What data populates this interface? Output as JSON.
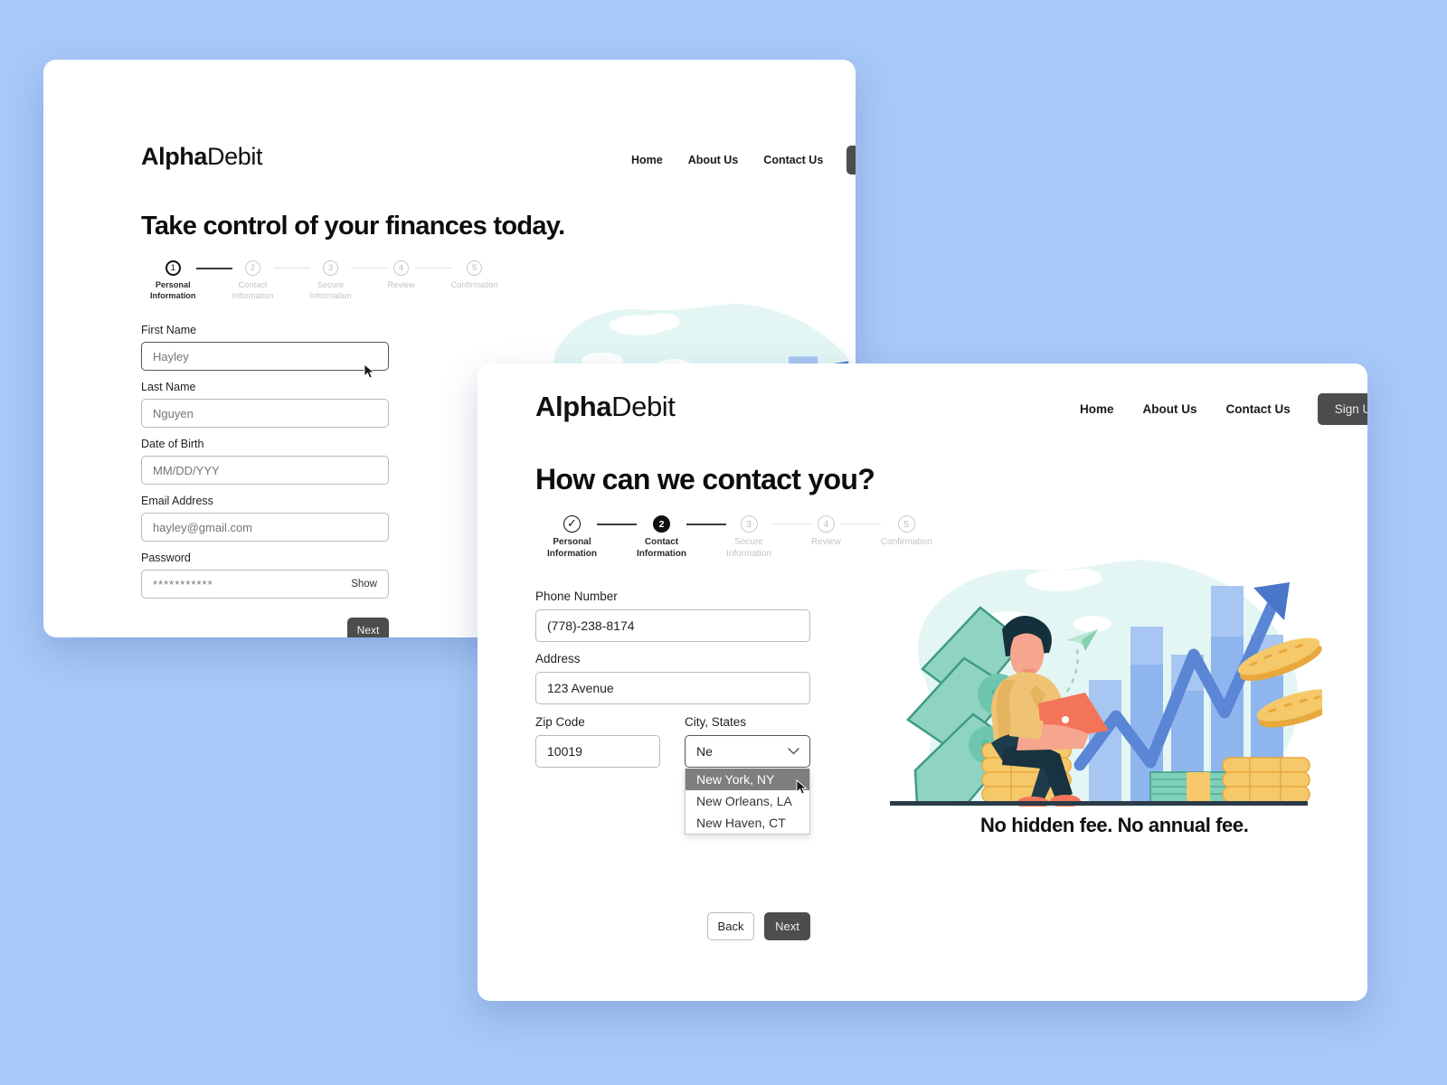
{
  "page": {
    "background_color": "#a8c8f9",
    "accent_dark": "#4d4d4d",
    "text_dark": "#111111",
    "muted_gray": "#c4c4c4"
  },
  "brand": {
    "bold_part": "Alpha",
    "light_part": "Debit"
  },
  "nav": {
    "links": [
      {
        "label": "Home"
      },
      {
        "label": "About Us"
      },
      {
        "label": "Contact Us"
      }
    ],
    "signup_label": "Sign Up"
  },
  "window_back": {
    "headline": "Take control of your finances today.",
    "stepper": [
      {
        "number": "1",
        "line1": "Personal",
        "line2": "Information",
        "state": "active"
      },
      {
        "number": "2",
        "line1": "Contact",
        "line2": "Information",
        "state": "pending"
      },
      {
        "number": "3",
        "line1": "Secure",
        "line2": "Information",
        "state": "pending"
      },
      {
        "number": "4",
        "line1": "Review",
        "line2": "",
        "state": "pending"
      },
      {
        "number": "5",
        "line1": "Confirmation",
        "line2": "",
        "state": "pending"
      }
    ],
    "fields": {
      "first_name": {
        "label": "First Name",
        "placeholder": "Hayley",
        "value": ""
      },
      "last_name": {
        "label": "Last Name",
        "placeholder": "Nguyen",
        "value": ""
      },
      "date_of_birth": {
        "label": "Date of Birth",
        "placeholder": "MM/DD/YYY",
        "value": ""
      },
      "email": {
        "label": "Email Address",
        "placeholder": "hayley@gmail.com",
        "value": ""
      },
      "password": {
        "label": "Password",
        "value": "***********",
        "show_label": "Show"
      }
    },
    "next_label": "Next"
  },
  "window_front": {
    "headline": "How can we contact you?",
    "stepper": [
      {
        "number": "✓",
        "line1": "Personal",
        "line2": "Information",
        "state": "done"
      },
      {
        "number": "2",
        "line1": "Contact",
        "line2": "Information",
        "state": "filled"
      },
      {
        "number": "3",
        "line1": "Secure",
        "line2": "Information",
        "state": "pending"
      },
      {
        "number": "4",
        "line1": "Review",
        "line2": "",
        "state": "pending"
      },
      {
        "number": "5",
        "line1": "Confirmation",
        "line2": "",
        "state": "pending"
      }
    ],
    "fields": {
      "phone": {
        "label": "Phone Number",
        "value": "(778)-238-8174"
      },
      "address": {
        "label": "Address",
        "value": "123 Avenue"
      },
      "zip": {
        "label": "Zip Code",
        "value": "10019"
      },
      "city_state": {
        "label": "City, States",
        "value": "Ne"
      }
    },
    "dropdown_options": [
      {
        "label": "New York,  NY",
        "highlighted": true
      },
      {
        "label": "New Orleans, LA",
        "highlighted": false
      },
      {
        "label": "New Haven, CT",
        "highlighted": false
      }
    ],
    "back_label": "Back",
    "next_label": "Next",
    "tagline": "No hidden fee. No annual fee."
  }
}
